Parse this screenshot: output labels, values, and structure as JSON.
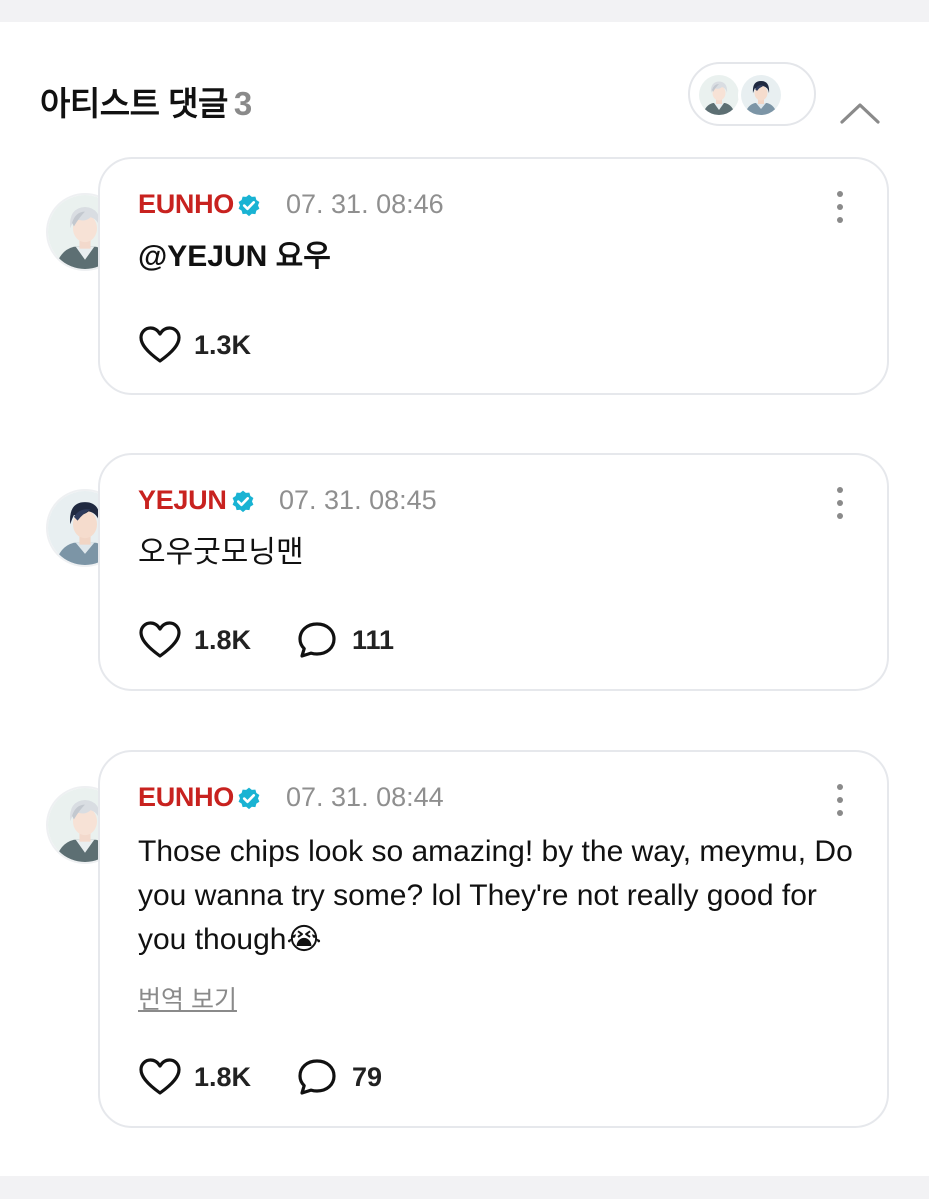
{
  "header": {
    "title": "아티스트 댓글",
    "count": "3"
  },
  "comments": [
    {
      "author": "EUNHO",
      "time": "07. 31. 08:46",
      "text": "@YEJUN 요우",
      "likes": "1.3K"
    },
    {
      "author": "YEJUN",
      "time": "07. 31. 08:45",
      "text": "오우굿모닝맨",
      "likes": "1.8K",
      "replies": "111"
    },
    {
      "author": "EUNHO",
      "time": "07. 31. 08:44",
      "text": "Those chips look so amazing! by the way, meymu, Do you wanna try some? lol They're not really good for you though😭",
      "translate_label": "번역 보기",
      "likes": "1.8K",
      "replies": "79"
    }
  ],
  "colors": {
    "author_name": "#c8221f",
    "verified_badge": "#19b3d3",
    "timestamp": "#8f8f8f",
    "card_border": "#e6e8ec",
    "background": "#f2f2f4"
  },
  "icons": [
    "verified-badge-icon",
    "more-vertical-icon",
    "heart-icon",
    "comment-bubble-icon",
    "chevron-up-icon"
  ]
}
